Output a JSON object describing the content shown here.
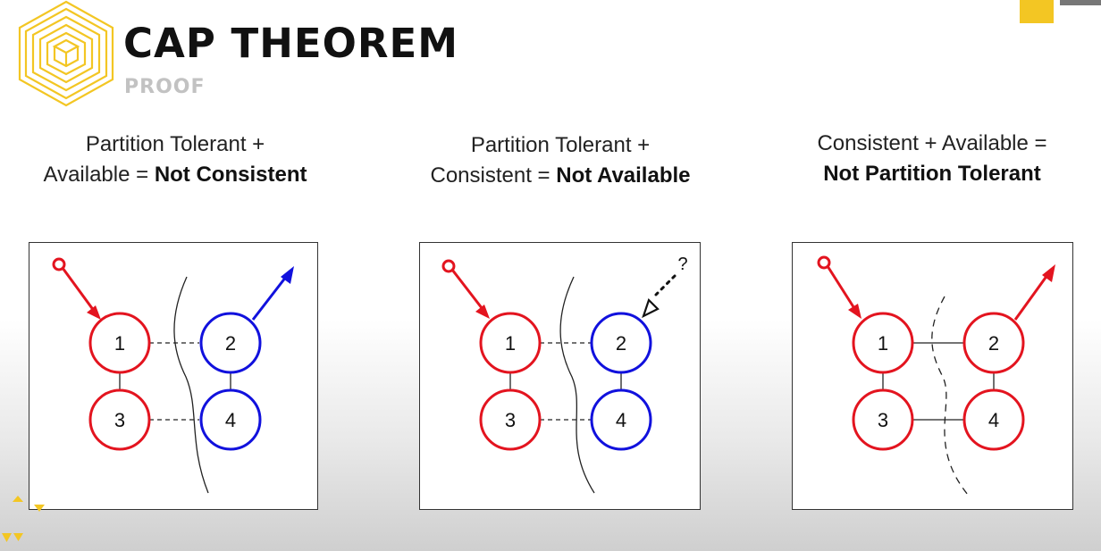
{
  "header": {
    "title": "CAP THEOREM",
    "subtitle": "PROOF"
  },
  "colors": {
    "accent_yellow": "#f3c623",
    "red": "#e3141f",
    "blue": "#1111dd"
  },
  "panels": [
    {
      "caption_line1": "Partition Tolerant +",
      "caption_line2_prefix": "Available = ",
      "caption_line2_bold": "Not Consistent",
      "nodes": [
        "1",
        "2",
        "3",
        "4"
      ]
    },
    {
      "caption_line1": "Partition Tolerant +",
      "caption_line2_prefix": "Consistent = ",
      "caption_line2_bold": "Not Available",
      "nodes": [
        "1",
        "2",
        "3",
        "4"
      ],
      "query_mark": "?"
    },
    {
      "caption_line1": "Consistent + Available =",
      "caption_line2_bold": "Not Partition Tolerant",
      "nodes": [
        "1",
        "2",
        "3",
        "4"
      ]
    }
  ]
}
